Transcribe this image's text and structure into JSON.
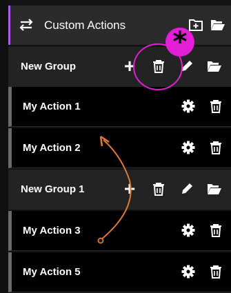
{
  "header": {
    "title": "Custom Actions",
    "icons": [
      "swap-arrows-icon",
      "add-folder-icon",
      "open-folder-icon"
    ]
  },
  "groups": [
    {
      "label": "New Group",
      "actions": [
        {
          "label": "My Action 1"
        },
        {
          "label": "My Action 2"
        }
      ]
    },
    {
      "label": "New Group 1",
      "actions": [
        {
          "label": "My Action 3"
        },
        {
          "label": "My Action 5"
        }
      ]
    }
  ],
  "annotations": {
    "highlight_symbol": "*",
    "highlight_color": "#e21fd6",
    "arrow_color": "#e07b2b"
  },
  "colors": {
    "accent": "#a45fe6",
    "header_bg": "#2b2b2b",
    "group_bg": "#232323",
    "action_bg": "#000000"
  }
}
